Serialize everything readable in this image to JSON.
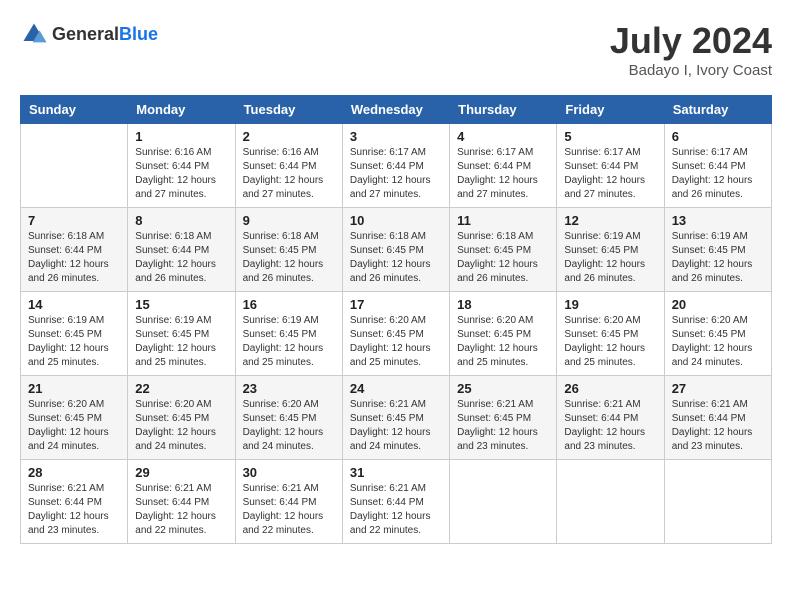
{
  "header": {
    "logo_general": "General",
    "logo_blue": "Blue",
    "month_year": "July 2024",
    "location": "Badayo I, Ivory Coast"
  },
  "days_of_week": [
    "Sunday",
    "Monday",
    "Tuesday",
    "Wednesday",
    "Thursday",
    "Friday",
    "Saturday"
  ],
  "weeks": [
    [
      {
        "day": "",
        "info": ""
      },
      {
        "day": "1",
        "info": "Sunrise: 6:16 AM\nSunset: 6:44 PM\nDaylight: 12 hours\nand 27 minutes."
      },
      {
        "day": "2",
        "info": "Sunrise: 6:16 AM\nSunset: 6:44 PM\nDaylight: 12 hours\nand 27 minutes."
      },
      {
        "day": "3",
        "info": "Sunrise: 6:17 AM\nSunset: 6:44 PM\nDaylight: 12 hours\nand 27 minutes."
      },
      {
        "day": "4",
        "info": "Sunrise: 6:17 AM\nSunset: 6:44 PM\nDaylight: 12 hours\nand 27 minutes."
      },
      {
        "day": "5",
        "info": "Sunrise: 6:17 AM\nSunset: 6:44 PM\nDaylight: 12 hours\nand 27 minutes."
      },
      {
        "day": "6",
        "info": "Sunrise: 6:17 AM\nSunset: 6:44 PM\nDaylight: 12 hours\nand 26 minutes."
      }
    ],
    [
      {
        "day": "7",
        "info": "Sunrise: 6:18 AM\nSunset: 6:44 PM\nDaylight: 12 hours\nand 26 minutes."
      },
      {
        "day": "8",
        "info": "Sunrise: 6:18 AM\nSunset: 6:44 PM\nDaylight: 12 hours\nand 26 minutes."
      },
      {
        "day": "9",
        "info": "Sunrise: 6:18 AM\nSunset: 6:45 PM\nDaylight: 12 hours\nand 26 minutes."
      },
      {
        "day": "10",
        "info": "Sunrise: 6:18 AM\nSunset: 6:45 PM\nDaylight: 12 hours\nand 26 minutes."
      },
      {
        "day": "11",
        "info": "Sunrise: 6:18 AM\nSunset: 6:45 PM\nDaylight: 12 hours\nand 26 minutes."
      },
      {
        "day": "12",
        "info": "Sunrise: 6:19 AM\nSunset: 6:45 PM\nDaylight: 12 hours\nand 26 minutes."
      },
      {
        "day": "13",
        "info": "Sunrise: 6:19 AM\nSunset: 6:45 PM\nDaylight: 12 hours\nand 26 minutes."
      }
    ],
    [
      {
        "day": "14",
        "info": "Sunrise: 6:19 AM\nSunset: 6:45 PM\nDaylight: 12 hours\nand 25 minutes."
      },
      {
        "day": "15",
        "info": "Sunrise: 6:19 AM\nSunset: 6:45 PM\nDaylight: 12 hours\nand 25 minutes."
      },
      {
        "day": "16",
        "info": "Sunrise: 6:19 AM\nSunset: 6:45 PM\nDaylight: 12 hours\nand 25 minutes."
      },
      {
        "day": "17",
        "info": "Sunrise: 6:20 AM\nSunset: 6:45 PM\nDaylight: 12 hours\nand 25 minutes."
      },
      {
        "day": "18",
        "info": "Sunrise: 6:20 AM\nSunset: 6:45 PM\nDaylight: 12 hours\nand 25 minutes."
      },
      {
        "day": "19",
        "info": "Sunrise: 6:20 AM\nSunset: 6:45 PM\nDaylight: 12 hours\nand 25 minutes."
      },
      {
        "day": "20",
        "info": "Sunrise: 6:20 AM\nSunset: 6:45 PM\nDaylight: 12 hours\nand 24 minutes."
      }
    ],
    [
      {
        "day": "21",
        "info": "Sunrise: 6:20 AM\nSunset: 6:45 PM\nDaylight: 12 hours\nand 24 minutes."
      },
      {
        "day": "22",
        "info": "Sunrise: 6:20 AM\nSunset: 6:45 PM\nDaylight: 12 hours\nand 24 minutes."
      },
      {
        "day": "23",
        "info": "Sunrise: 6:20 AM\nSunset: 6:45 PM\nDaylight: 12 hours\nand 24 minutes."
      },
      {
        "day": "24",
        "info": "Sunrise: 6:21 AM\nSunset: 6:45 PM\nDaylight: 12 hours\nand 24 minutes."
      },
      {
        "day": "25",
        "info": "Sunrise: 6:21 AM\nSunset: 6:45 PM\nDaylight: 12 hours\nand 23 minutes."
      },
      {
        "day": "26",
        "info": "Sunrise: 6:21 AM\nSunset: 6:44 PM\nDaylight: 12 hours\nand 23 minutes."
      },
      {
        "day": "27",
        "info": "Sunrise: 6:21 AM\nSunset: 6:44 PM\nDaylight: 12 hours\nand 23 minutes."
      }
    ],
    [
      {
        "day": "28",
        "info": "Sunrise: 6:21 AM\nSunset: 6:44 PM\nDaylight: 12 hours\nand 23 minutes."
      },
      {
        "day": "29",
        "info": "Sunrise: 6:21 AM\nSunset: 6:44 PM\nDaylight: 12 hours\nand 22 minutes."
      },
      {
        "day": "30",
        "info": "Sunrise: 6:21 AM\nSunset: 6:44 PM\nDaylight: 12 hours\nand 22 minutes."
      },
      {
        "day": "31",
        "info": "Sunrise: 6:21 AM\nSunset: 6:44 PM\nDaylight: 12 hours\nand 22 minutes."
      },
      {
        "day": "",
        "info": ""
      },
      {
        "day": "",
        "info": ""
      },
      {
        "day": "",
        "info": ""
      }
    ]
  ]
}
